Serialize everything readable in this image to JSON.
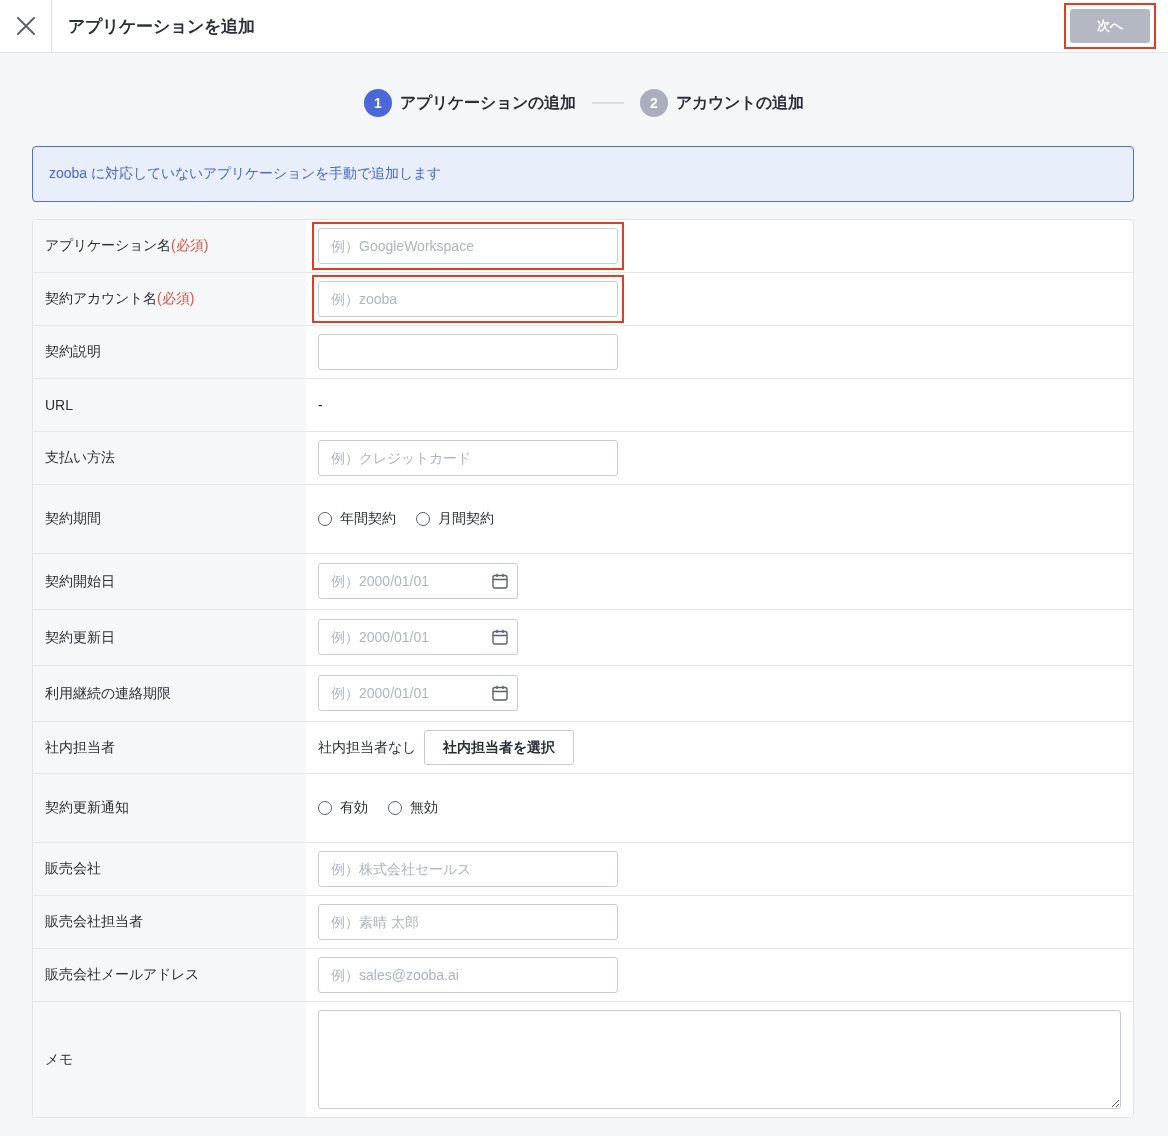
{
  "header": {
    "title": "アプリケーションを追加",
    "next_button": {
      "label": "次へ",
      "disabled": true,
      "highlighted": true
    }
  },
  "steps": [
    {
      "number": "1",
      "label": "アプリケーションの追加",
      "selected": true
    },
    {
      "number": "2",
      "label": "アカウントの追加",
      "selected": false
    }
  ],
  "notice": "zooba に対応していないアプリケーションを手動で追加します",
  "form": {
    "rows": [
      {
        "kind": "text",
        "label": "アプリケーション名",
        "required_note": "(必須)",
        "placeholder": "例）GoogleWorkspace",
        "highlighted": true
      },
      {
        "kind": "text",
        "label": "契約アカウント名",
        "required_note": "(必須)",
        "placeholder": "例）zooba",
        "highlighted": true
      },
      {
        "kind": "text",
        "label": "契約説明",
        "highlighted": false
      },
      {
        "kind": "plain",
        "label": "URL",
        "value": "-"
      },
      {
        "kind": "text",
        "label": "支払い方法",
        "placeholder": "例）クレジットカード",
        "highlighted": false
      },
      {
        "kind": "radio",
        "label": "契約期間",
        "options": [
          {
            "label": "年間契約",
            "selected": false
          },
          {
            "label": "月間契約",
            "selected": false
          }
        ]
      },
      {
        "kind": "date",
        "label": "契約開始日",
        "placeholder": "例）2000/01/01"
      },
      {
        "kind": "date",
        "label": "契約更新日",
        "placeholder": "例）2000/01/01"
      },
      {
        "kind": "date",
        "label": "利用継続の連絡期限",
        "placeholder": "例）2000/01/01"
      },
      {
        "kind": "person",
        "label": "社内担当者",
        "value": "社内担当者なし",
        "button": "社内担当者を選択"
      },
      {
        "kind": "radio",
        "label": "契約更新通知",
        "options": [
          {
            "label": "有効",
            "selected": false
          },
          {
            "label": "無効",
            "selected": false
          }
        ]
      },
      {
        "kind": "text",
        "label": "販売会社",
        "placeholder": "例）株式会社セールス",
        "highlighted": false
      },
      {
        "kind": "text",
        "label": "販売会社担当者",
        "placeholder": "例）素晴 太郎",
        "highlighted": false
      },
      {
        "kind": "text",
        "label": "販売会社メールアドレス",
        "placeholder": "例）sales@zooba.ai",
        "highlighted": false
      },
      {
        "kind": "textarea",
        "label": "メモ"
      }
    ]
  }
}
